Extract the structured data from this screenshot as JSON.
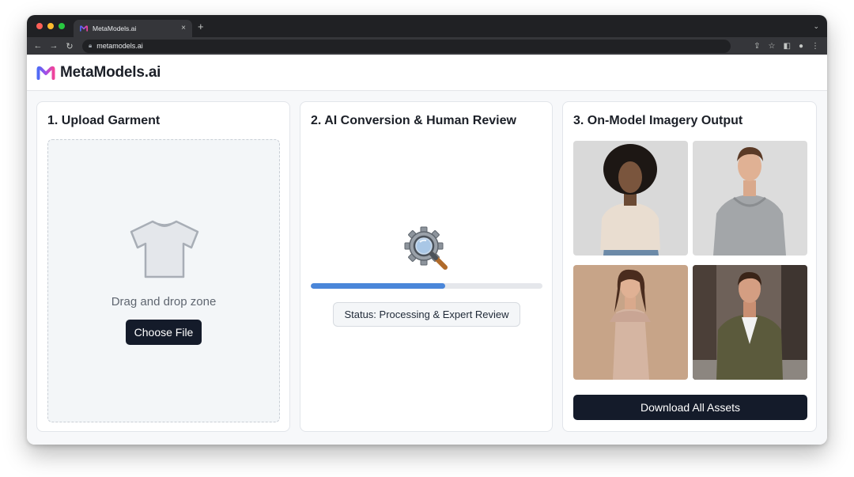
{
  "browser": {
    "tab_title": "MetaModels.ai",
    "tab_close": "×",
    "new_tab": "+",
    "url": "metamodels.ai",
    "tab_menu_icon": "chevron-down-icon",
    "nav_icons": [
      "back-arrow-icon",
      "forward-arrow-icon",
      "reload-icon"
    ],
    "toolbar_icons": [
      "share-icon",
      "star-icon",
      "side-panel-icon",
      "profile-icon",
      "more-menu-icon"
    ]
  },
  "app": {
    "logo_text": "MetaModels.ai",
    "brand_gradient": [
      "#4f6bf5",
      "#a34ee8",
      "#f0449a"
    ]
  },
  "cards": {
    "upload": {
      "title": "1. Upload Garment",
      "dropzone_text": "Drag and drop zone",
      "button_label": "Choose File",
      "icon": "t-shirt-icon"
    },
    "conversion": {
      "title": "2. AI Conversion & Human Review",
      "icon": "gear-magnifier-icon",
      "progress": 0.58,
      "status_text": "Status: Processing & Expert Review",
      "progress_color": "#4a86d9"
    },
    "output": {
      "title": "3. On-Model Imagery Output",
      "images": [
        {
          "name": "model-photo-beige-tshirt"
        },
        {
          "name": "model-photo-grey-hoodie"
        },
        {
          "name": "model-photo-beige-dress"
        },
        {
          "name": "model-photo-olive-jacket"
        }
      ],
      "button_label": "Download All Assets"
    }
  },
  "colors": {
    "primary_button": "#141b2a",
    "accent_blue": "#4a86d9"
  }
}
